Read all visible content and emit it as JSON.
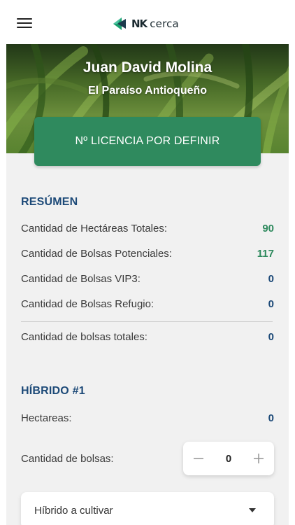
{
  "header": {
    "logo_brand": "NK",
    "logo_text": "cerca"
  },
  "profile": {
    "name": "Juan David Molina",
    "farm": "El Paraíso Antioqueño",
    "license_button": "Nº LICENCIA POR DEFINIR"
  },
  "summary": {
    "title": "RESÚMEN",
    "rows": [
      {
        "label": "Cantidad de Hectáreas Totales:",
        "value": "90"
      },
      {
        "label": "Cantidad de Bolsas Potenciales:",
        "value": "117"
      },
      {
        "label": "Cantidad de Bolsas VIP3:",
        "value": "0"
      },
      {
        "label": "Cantidad de Bolsas Refugio:",
        "value": "0"
      }
    ],
    "total": {
      "label": "Cantidad de bolsas totales:",
      "value": "0"
    }
  },
  "hybrid": {
    "title": "HÍBRIDO #1",
    "hectares_label": "Hectareas:",
    "hectares_value": "0",
    "bags_label": "Cantidad de bolsas:",
    "bags_value": "0",
    "select_placeholder": "Híbrido a cultivar"
  },
  "colors": {
    "accent_green": "#2f8a5e",
    "accent_blue": "#1d4a78"
  },
  "icons": [
    "menu-icon",
    "nk-logo-icon",
    "minus-icon",
    "plus-icon",
    "chevron-down-icon"
  ]
}
